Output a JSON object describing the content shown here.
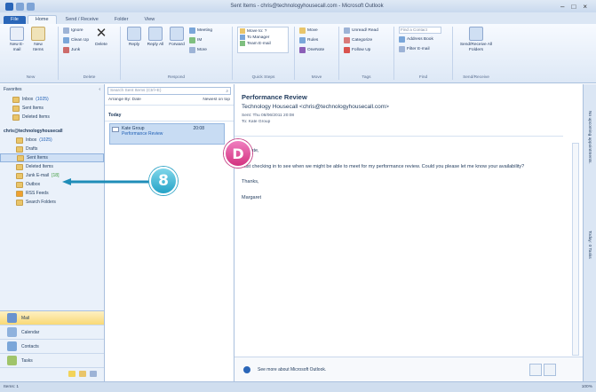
{
  "window": {
    "title": "Sent Items - chris@technologyhousecall.com - Microsoft Outlook"
  },
  "ribbon_tabs": [
    "File",
    "Home",
    "Send / Receive",
    "Folder",
    "View"
  ],
  "ribbon": {
    "new_group": {
      "new_email": "New E-mail",
      "new_items": "New Items",
      "label": "New"
    },
    "delete_group": {
      "ignore": "Ignore",
      "clean_up": "Clean Up",
      "junk": "Junk",
      "delete": "Delete",
      "label": "Delete"
    },
    "respond_group": {
      "reply": "Reply",
      "reply_all": "Reply All",
      "forward": "Forward",
      "meeting": "Meeting",
      "im": "IM",
      "more": "More",
      "label": "Respond"
    },
    "quick_steps": {
      "move_to": "Move to: ?",
      "to_manager": "To Manager",
      "team_email": "Team E-mail",
      "label": "Quick Steps"
    },
    "move_group": {
      "move": "Move",
      "rules": "Rules",
      "onenote": "OneNote",
      "label": "Move"
    },
    "tags_group": {
      "unread_read": "Unread/ Read",
      "categorize": "Categorize",
      "follow_up": "Follow Up",
      "label": "Tags"
    },
    "find_group": {
      "search_contacts": "Find a Contact",
      "address_book": "Address Book",
      "filter_email": "Filter E-mail",
      "label": "Find"
    },
    "send_receive_group": {
      "send_receive_all": "Send/Receive All Folders",
      "label": "Send/Receive"
    }
  },
  "nav": {
    "favorites_label": "Favorites",
    "favorites": [
      {
        "name": "Inbox",
        "count": "(1025)"
      },
      {
        "name": "Sent Items",
        "count": ""
      },
      {
        "name": "Deleted Items",
        "count": ""
      }
    ],
    "account": "chris@technologyhousecall",
    "folders": [
      {
        "name": "Inbox",
        "count": "(1025)"
      },
      {
        "name": "Drafts",
        "count": ""
      },
      {
        "name": "Sent Items",
        "count": ""
      },
      {
        "name": "Deleted Items",
        "count": ""
      },
      {
        "name": "Junk E-mail",
        "count": "[18]"
      },
      {
        "name": "Outbox",
        "count": ""
      },
      {
        "name": "RSS Feeds",
        "count": ""
      },
      {
        "name": "Search Folders",
        "count": ""
      }
    ],
    "modules": [
      "Mail",
      "Calendar",
      "Contacts",
      "Tasks"
    ]
  },
  "message_list": {
    "search_placeholder": "Search Sent Items (Ctrl+E)",
    "arrange_by": "Arrange By: Date",
    "order": "Newest on top",
    "group_header": "Today",
    "items": [
      {
        "from": "Kate Group",
        "time": "20:08",
        "subject": "Performance Review"
      }
    ]
  },
  "reading_pane": {
    "subject": "Performance Review",
    "from": "Technology Housecall <chris@technologyhousecall.com>",
    "sent": "Sent: Thu 08/06/2011 20:08",
    "to": "To: Kate Group",
    "body": [
      "Hi Kate,",
      "Just checking in to see when we might be able to meet for my performance review. Could you please let me know your availability?",
      "Thanks,",
      "Margaret"
    ],
    "people_pane": "See more about Microsoft Outlook."
  },
  "todo_bar": {
    "labels": [
      "No upcoming appointments.",
      "Today: 0 Tasks"
    ]
  },
  "status_bar": {
    "left": "Items: 1",
    "zoom": "100%"
  },
  "callouts": {
    "step": "8",
    "tip": "D"
  },
  "colors": {
    "callout_step": "#25a3c7",
    "callout_tip": "#d3327f",
    "file_tab": "#2a66b8"
  }
}
